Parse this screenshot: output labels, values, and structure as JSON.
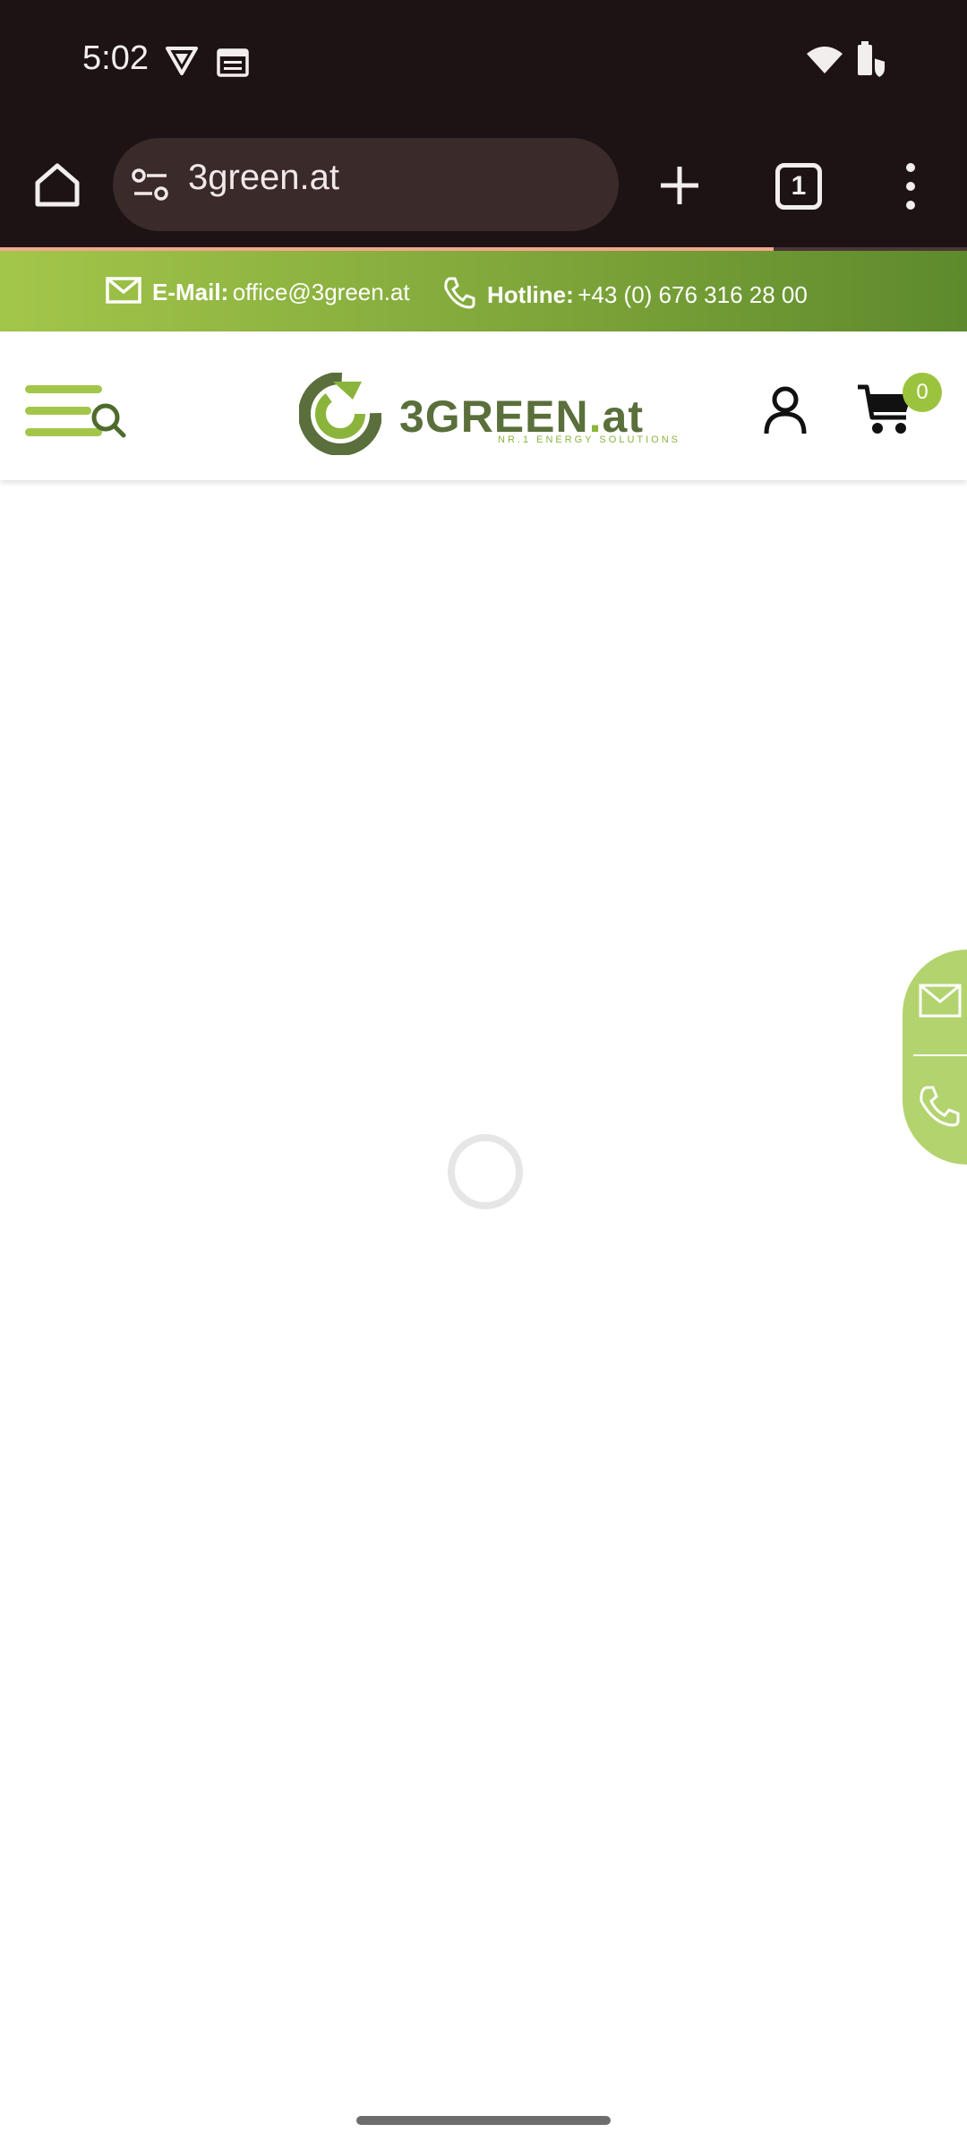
{
  "status_bar": {
    "time": "5:02",
    "icons": [
      "vpn-shield-icon",
      "calendar-icon",
      "wifi-icon",
      "battery-saver-icon"
    ]
  },
  "browser": {
    "url": "3green.at",
    "tab_count": "1",
    "toolbar_icons": [
      "home-icon",
      "site-settings-icon",
      "new-tab-icon",
      "tab-switcher-icon",
      "more-options-icon"
    ],
    "page_load_progress_percent": 80
  },
  "contact_bar": {
    "email_label": "E-Mail:",
    "email_value": "office@3green.at",
    "hotline_label": "Hotline:",
    "hotline_value": "+43 (0) 676 316 28 00"
  },
  "header": {
    "logo_main": "3GREEN",
    "logo_dot": ".",
    "logo_tld": "at",
    "logo_tagline": "NR.1 ENERGY SOLUTIONS",
    "cart_count": "0"
  },
  "colors": {
    "brand_green": "#8bb43c",
    "brand_dark_green": "#5a6f3b",
    "status_bar_bg": "#1d1314",
    "url_pill_bg": "#3a2a29",
    "float_tab_bg": "#b3d36f"
  },
  "floating_contact": {
    "icons": [
      "mail-icon",
      "phone-icon"
    ]
  }
}
